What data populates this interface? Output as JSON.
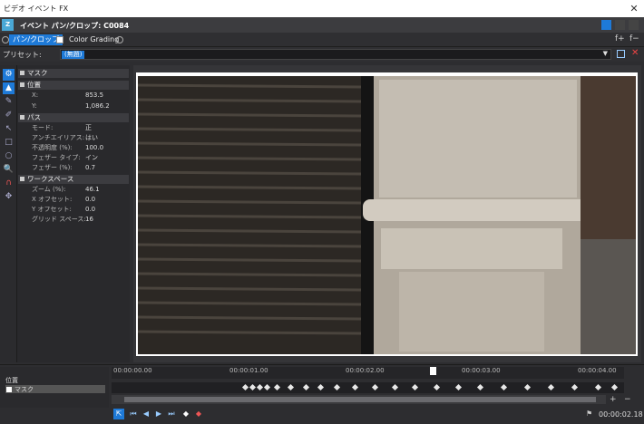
{
  "window": {
    "title": "ビデオ イベント FX",
    "close_glyph": "✕"
  },
  "header": {
    "title": "イベント パン/クロップ: C0084"
  },
  "plugins": {
    "tab1": "パン/クロップ",
    "tab2": "Color Grading",
    "tab2_checked": true
  },
  "preset": {
    "label": "プリセット:",
    "value": "(無題)"
  },
  "sections": {
    "mask": "マスク",
    "position": "位置",
    "x_label": "X:",
    "x_value": "853.5",
    "y_label": "Y:",
    "y_value": "1,086.2",
    "path": "パス",
    "mode_label": "モード:",
    "mode_value": "正",
    "aa_label": "アンチエイリアス:",
    "aa_value": "はい",
    "opacity_label": "不透明度 (%):",
    "opacity_value": "100.0",
    "feather_type_label": "フェザー タイプ:",
    "feather_type_value": "イン",
    "feather_label": "フェザー (%):",
    "feather_value": "0.7",
    "workspace": "ワークスペース",
    "zoom_label": "ズーム (%):",
    "zoom_value": "46.1",
    "xoff_label": "X オフセット:",
    "xoff_value": "0.0",
    "yoff_label": "Y オフセット:",
    "yoff_value": "0.0",
    "grid_label": "グリッド スペース:",
    "grid_value": "16"
  },
  "timeline": {
    "ticks": [
      "00:00:00.00",
      "00:00:01.00",
      "00:00:02.00",
      "00:00:03.00",
      "00:00:04.00"
    ],
    "track_position": "位置",
    "track_mask": "マスク",
    "time": "00:00:02.18"
  },
  "colors": {
    "accent": "#1e7ad8",
    "header": "#3c3c3f"
  }
}
